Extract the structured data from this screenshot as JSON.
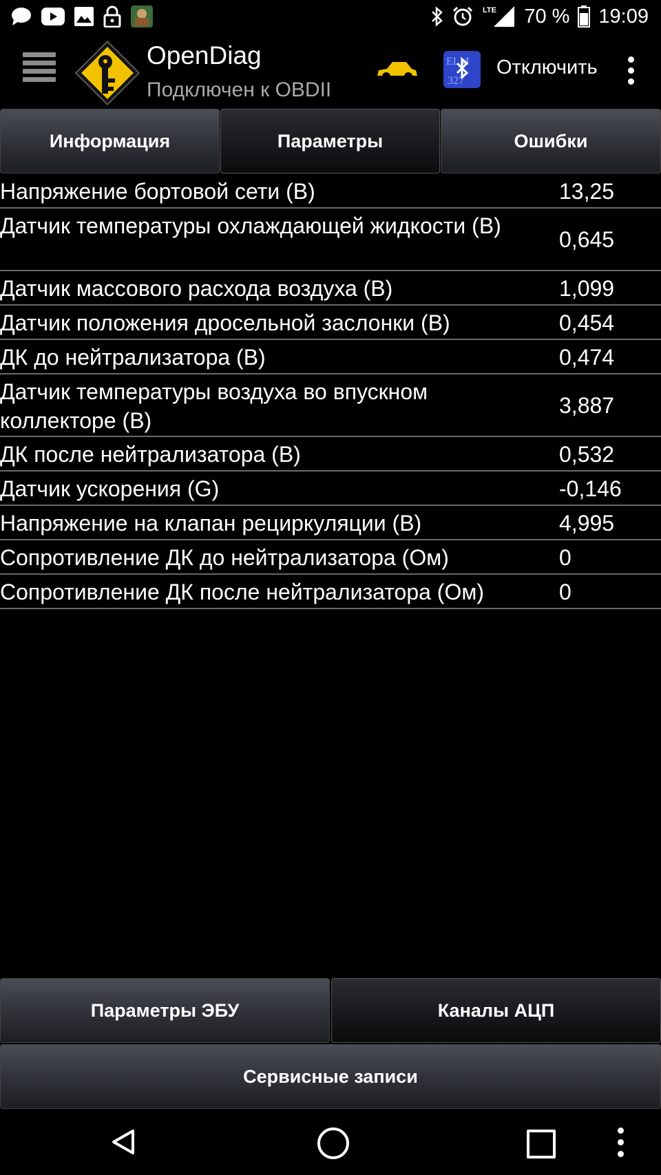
{
  "status_bar": {
    "left_icons": [
      "message-icon",
      "youtube-icon",
      "image-icon",
      "lock-icon",
      "game-app-icon"
    ],
    "right_icons": [
      "bluetooth-icon",
      "alarm-icon",
      "lte-icon",
      "signal-icon",
      "battery-icon"
    ],
    "lte_label": "LTE",
    "battery": "70 %",
    "time": "19:09"
  },
  "app_bar": {
    "title": "OpenDiag",
    "subtitle": "Подключен к OBDII",
    "disconnect_label": "Отключить",
    "car_color": "#f2c200",
    "bt_logo_color": "#2e45c9"
  },
  "tabs": [
    {
      "label": "Информация",
      "active": false
    },
    {
      "label": "Параметры",
      "active": true
    },
    {
      "label": "Ошибки",
      "active": false
    }
  ],
  "parameters": [
    {
      "name": "Напряжение бортовой сети (В)",
      "value": "13,25"
    },
    {
      "name": "Датчик температуры охлаждающей жидкости (В)",
      "value": "0,645"
    },
    {
      "name": "Датчик массового расхода воздуха (В)",
      "value": "1,099"
    },
    {
      "name": "Датчик положения дросельной заслонки (В)",
      "value": "0,454"
    },
    {
      "name": "ДК до нейтрализатора (В)",
      "value": "0,474"
    },
    {
      "name": "Датчик температуры воздуха во впускном коллекторе (В)",
      "value": "3,887"
    },
    {
      "name": "ДК после нейтрализатора (В)",
      "value": "0,532"
    },
    {
      "name": "Датчик ускорения (G)",
      "value": "-0,146"
    },
    {
      "name": "Напряжение на клапан рециркуляции (В)",
      "value": "4,995"
    },
    {
      "name": "Сопротивление ДК до нейтрализатора (Ом)",
      "value": "0"
    },
    {
      "name": "Сопротивление ДК после нейтрализатора (Ом)",
      "value": "0"
    }
  ],
  "bottom_buttons": {
    "ecu_params": "Параметры ЭБУ",
    "adc_channels": "Каналы АЦП",
    "service_records": "Сервисные записи"
  },
  "nav_bar": {
    "icons": [
      "back-icon",
      "home-icon",
      "recents-icon",
      "more-icon"
    ]
  }
}
